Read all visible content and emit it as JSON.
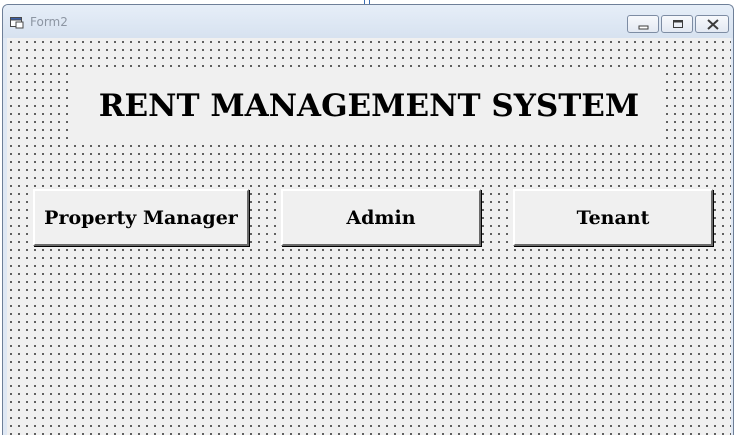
{
  "window": {
    "title": "Form2",
    "icon": "form-window-icon",
    "controls": [
      "minimize-icon",
      "maximize-icon",
      "close-icon"
    ]
  },
  "form": {
    "heading": "RENT MANAGEMENT SYSTEM",
    "grid": "dotted design grid",
    "buttons": {
      "property_manager": "Property Manager",
      "admin": "Admin",
      "tenant": "Tenant"
    }
  },
  "colors": {
    "form_background": "#f0f0f0",
    "titlebar": "#dfe8f4",
    "title_text": "#8d96a3"
  }
}
